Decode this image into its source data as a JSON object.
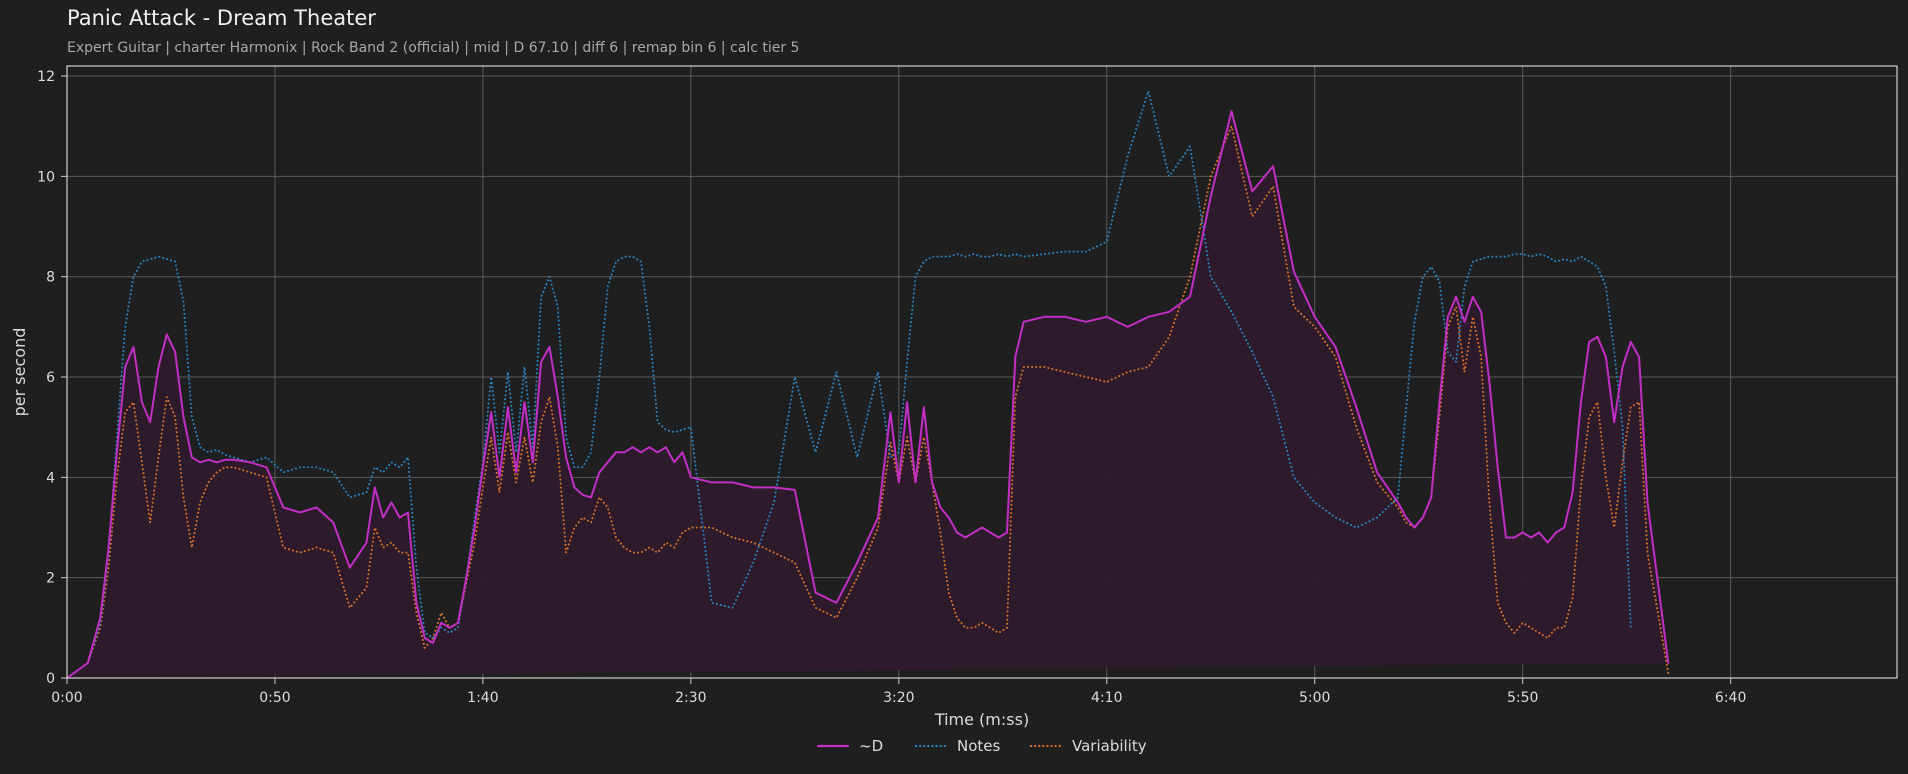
{
  "header": {
    "title": "Panic Attack - Dream Theater",
    "subtitle": "Expert Guitar  |  charter Harmonix  |  Rock Band 2 (official)  |  mid  |  D 67.10  |  diff 6  |  remap bin 6  |  calc tier 5"
  },
  "colors": {
    "background": "#1f1f1f",
    "d_series": "#c12fc4",
    "notes_series": "#2a84c0",
    "variability_series": "#d8722a",
    "area_fill": "#2e1b2d",
    "grid": "#5a5a5a"
  },
  "chart_data": {
    "type": "line",
    "title": "Panic Attack - Dream Theater",
    "xlabel": "Time (m:ss)",
    "ylabel": "per second",
    "xlim": [
      0,
      440
    ],
    "ylim": [
      0,
      12.2
    ],
    "grid": true,
    "legend_position": "bottom-center",
    "x_ticks": [
      {
        "value": 0,
        "label": "0:00"
      },
      {
        "value": 50,
        "label": "0:50"
      },
      {
        "value": 100,
        "label": "1:40"
      },
      {
        "value": 150,
        "label": "2:30"
      },
      {
        "value": 200,
        "label": "3:20"
      },
      {
        "value": 250,
        "label": "4:10"
      },
      {
        "value": 300,
        "label": "5:00"
      },
      {
        "value": 350,
        "label": "5:50"
      },
      {
        "value": 400,
        "label": "6:40"
      }
    ],
    "y_ticks": [
      {
        "value": 0,
        "label": "0"
      },
      {
        "value": 2,
        "label": "2"
      },
      {
        "value": 4,
        "label": "4"
      },
      {
        "value": 6,
        "label": "6"
      },
      {
        "value": 8,
        "label": "8"
      },
      {
        "value": 10,
        "label": "10"
      },
      {
        "value": 12,
        "label": "12"
      }
    ],
    "x": [
      0,
      5,
      8,
      10,
      12,
      14,
      16,
      18,
      20,
      22,
      24,
      26,
      28,
      30,
      32,
      34,
      36,
      38,
      40,
      44,
      48,
      52,
      56,
      60,
      64,
      68,
      72,
      74,
      76,
      78,
      80,
      82,
      84,
      86,
      88,
      90,
      92,
      94,
      96,
      98,
      100,
      102,
      104,
      106,
      108,
      110,
      112,
      114,
      116,
      118,
      120,
      122,
      124,
      126,
      128,
      130,
      132,
      134,
      136,
      138,
      140,
      142,
      144,
      146,
      148,
      150,
      155,
      160,
      165,
      170,
      175,
      180,
      185,
      190,
      195,
      198,
      200,
      202,
      204,
      206,
      208,
      210,
      212,
      214,
      216,
      218,
      220,
      222,
      224,
      226,
      228,
      230,
      235,
      240,
      245,
      250,
      255,
      260,
      265,
      270,
      275,
      280,
      285,
      290,
      295,
      300,
      305,
      310,
      315,
      320,
      322,
      324,
      326,
      328,
      330,
      332,
      334,
      336,
      338,
      340,
      342,
      344,
      346,
      348,
      350,
      352,
      354,
      356,
      358,
      360,
      362,
      364,
      366,
      368,
      370,
      372,
      374,
      376,
      378,
      380,
      385,
      390,
      395,
      400,
      402,
      404,
      406,
      408,
      410,
      412,
      414,
      416,
      418,
      420,
      422,
      424,
      426,
      428,
      430,
      432,
      434,
      436,
      438,
      440
    ],
    "series": [
      {
        "name": "~D",
        "style": "solid",
        "values": [
          0,
          0.3,
          1.2,
          2.6,
          4.5,
          6.2,
          6.6,
          5.5,
          5.1,
          6.2,
          6.85,
          6.5,
          5.2,
          4.4,
          4.3,
          4.35,
          4.3,
          4.35,
          4.35,
          4.3,
          4.2,
          3.4,
          3.3,
          3.4,
          3.1,
          2.2,
          2.7,
          3.8,
          3.2,
          3.5,
          3.2,
          3.3,
          1.5,
          0.8,
          0.7,
          1.1,
          1,
          1.1,
          2,
          3,
          4.2,
          5.3,
          4,
          5.4,
          4.1,
          5.5,
          4.3,
          6.3,
          6.6,
          5.6,
          4.4,
          3.8,
          3.65,
          3.6,
          4.1,
          4.3,
          4.5,
          4.5,
          4.6,
          4.5,
          4.6,
          4.5,
          4.6,
          4.3,
          4.5,
          4,
          3.9,
          3.9,
          3.8,
          3.8,
          3.75,
          1.7,
          1.5,
          2.3,
          3.2,
          5.3,
          3.9,
          5.5,
          3.9,
          5.4,
          3.9,
          3.4,
          3.2,
          2.9,
          2.8,
          2.9,
          3,
          2.9,
          2.8,
          2.9,
          6.4,
          7.1,
          7.2,
          7.2,
          7.1,
          7.2,
          7,
          7.2,
          7.3,
          7.6,
          9.6,
          11.3,
          9.7,
          10.2,
          8.1,
          7.2,
          6.6,
          5.4,
          4.1,
          3.5,
          3.2,
          3,
          3.2,
          3.6,
          5.5,
          7.2,
          7.6,
          7.1,
          7.6,
          7.3,
          5.9,
          4.2,
          2.8,
          2.8,
          2.9,
          2.8,
          2.9,
          2.7,
          2.9,
          3,
          3.7,
          5.5,
          6.7,
          6.8,
          6.4,
          5.1,
          6.2,
          6.7,
          6.4,
          3.5,
          0.3
        ]
      },
      {
        "name": "Notes",
        "style": "dotted",
        "values": [
          0,
          0.3,
          1.1,
          2.5,
          4.8,
          7,
          8,
          8.3,
          8.35,
          8.4,
          8.35,
          8.3,
          7.5,
          5.2,
          4.6,
          4.5,
          4.55,
          4.45,
          4.4,
          4.3,
          4.4,
          4.1,
          4.2,
          4.2,
          4.1,
          3.6,
          3.7,
          4.2,
          4.1,
          4.3,
          4.2,
          4.4,
          2.2,
          0.9,
          0.8,
          1,
          0.9,
          1,
          2,
          3.2,
          4.3,
          6,
          4.5,
          6.1,
          4.5,
          6.2,
          4.6,
          7.6,
          8,
          7.4,
          4.8,
          4.2,
          4.2,
          4.5,
          6,
          7.8,
          8.3,
          8.4,
          8.4,
          8.3,
          7,
          5.1,
          4.95,
          4.9,
          4.95,
          5,
          1.5,
          1.4,
          2.3,
          3.5,
          6,
          4.5,
          6.1,
          4.4,
          6.1,
          4.4,
          4.5,
          6.3,
          8,
          8.3,
          8.4,
          8.4,
          8.4,
          8.45,
          8.4,
          8.45,
          8.4,
          8.4,
          8.45,
          8.4,
          8.45,
          8.4,
          8.45,
          8.5,
          8.5,
          8.7,
          10.4,
          11.7,
          10,
          10.6,
          8,
          7.3,
          6.5,
          5.6,
          4,
          3.5,
          3.2,
          3,
          3.2,
          3.6,
          5.4,
          7.1,
          8,
          8.2,
          7.9,
          6.5,
          6.3,
          7.8,
          8.3,
          8.35,
          8.4,
          8.4,
          8.4,
          8.45,
          8.45,
          8.4,
          8.45,
          8.4,
          8.3,
          8.35,
          8.3,
          8.4,
          8.3,
          8.2,
          7.8,
          6.5,
          5,
          1
        ]
      },
      {
        "name": "Variability",
        "style": "dotted",
        "values": [
          0,
          0.3,
          1,
          2.2,
          4,
          5.3,
          5.5,
          4.3,
          3.1,
          4.4,
          5.6,
          5.2,
          3.6,
          2.6,
          3.5,
          3.9,
          4.1,
          4.2,
          4.2,
          4.1,
          4,
          2.6,
          2.5,
          2.6,
          2.5,
          1.4,
          1.8,
          3,
          2.6,
          2.7,
          2.5,
          2.5,
          1.3,
          0.6,
          0.8,
          1.3,
          1,
          1.1,
          1.9,
          2.7,
          3.8,
          4.8,
          3.7,
          4.9,
          3.9,
          4.8,
          3.9,
          5.1,
          5.6,
          4.6,
          2.5,
          3,
          3.2,
          3.1,
          3.6,
          3.4,
          2.8,
          2.6,
          2.5,
          2.5,
          2.6,
          2.5,
          2.7,
          2.6,
          2.9,
          3,
          3,
          2.8,
          2.7,
          2.5,
          2.3,
          1.4,
          1.2,
          2,
          3,
          4.7,
          3.9,
          4.8,
          3.9,
          4.8,
          3.9,
          2.9,
          1.7,
          1.2,
          1,
          1,
          1.1,
          1,
          0.9,
          1,
          5.6,
          6.2,
          6.2,
          6.1,
          6,
          5.9,
          6.1,
          6.2,
          6.8,
          8,
          10,
          11,
          9.2,
          9.8,
          7.4,
          7,
          6.4,
          5,
          3.9,
          3.4,
          3.1,
          3,
          3.2,
          3.6,
          5.2,
          7,
          7.4,
          6.1,
          7.2,
          6.4,
          3.5,
          1.5,
          1.1,
          0.9,
          1.1,
          1,
          0.9,
          0.8,
          1,
          1,
          1.6,
          3.8,
          5.2,
          5.5,
          4,
          3,
          4.3,
          5.4,
          5.5,
          2.5,
          0.1
        ]
      }
    ],
    "legend": [
      "~D",
      "Notes",
      "Variability"
    ]
  }
}
